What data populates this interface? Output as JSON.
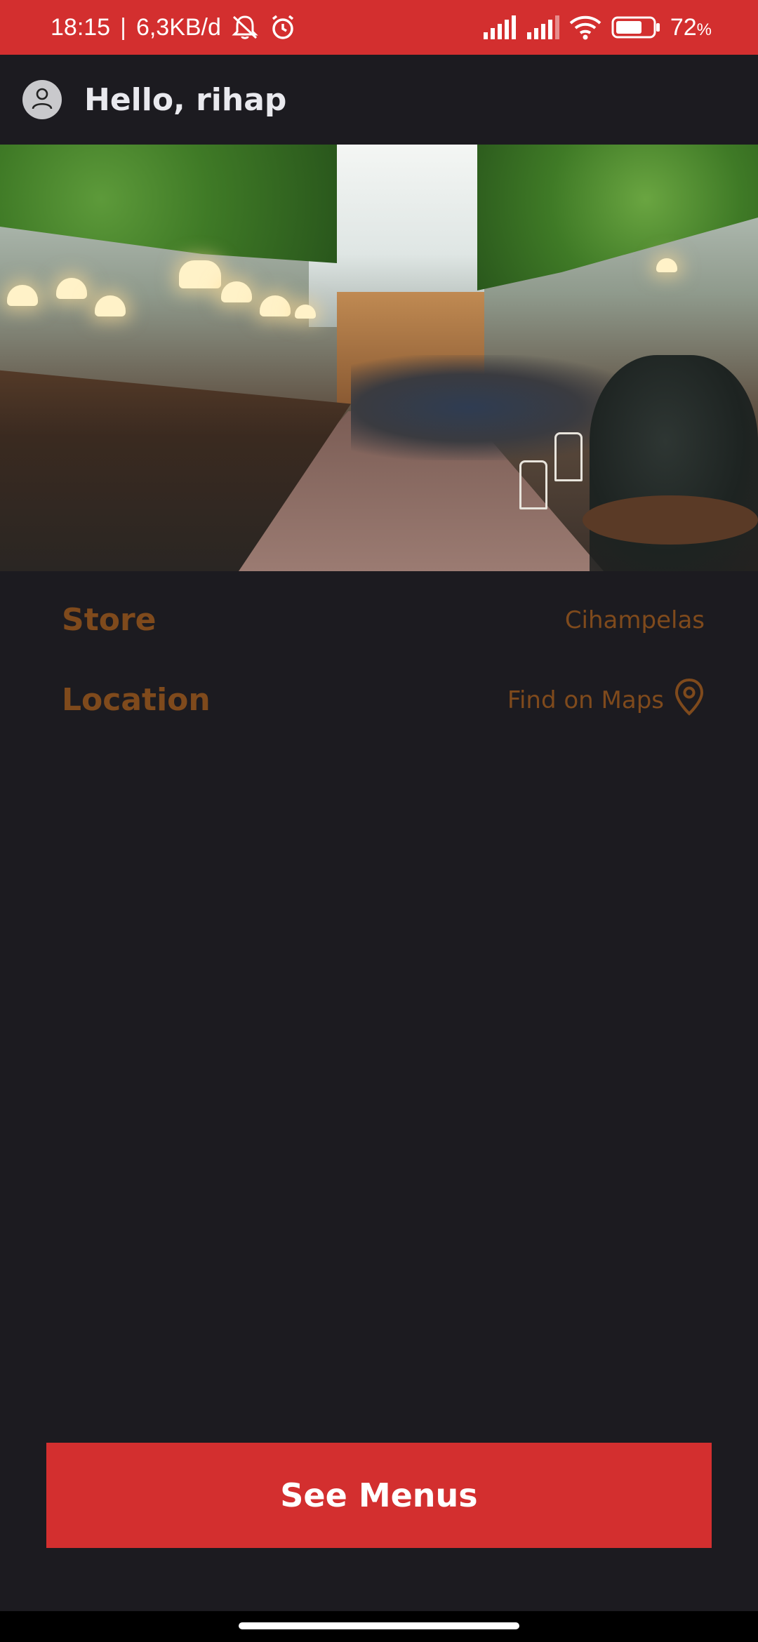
{
  "status_bar": {
    "time": "18:15",
    "separator": "|",
    "network_speed": "6,3KB/d",
    "battery_percent": "72",
    "battery_unit": "%",
    "battery_level": 0.72,
    "icons": [
      "mute-icon",
      "alarm-icon",
      "signal-icon",
      "signal-icon-2",
      "wifi-icon",
      "battery-icon"
    ]
  },
  "header": {
    "greeting": "Hello, rihap",
    "avatar_icon": "user-icon"
  },
  "hero": {
    "image": "restaurant-interior-photo"
  },
  "store": {
    "label": "Store",
    "value": "Cihampelas"
  },
  "location": {
    "label": "Location",
    "link_text": "Find on Maps",
    "icon": "map-pin-icon"
  },
  "actions": {
    "see_menus_label": "See Menus"
  },
  "colors": {
    "accent": "#d32f2f",
    "background": "#1c1b20",
    "info_text": "#7f4a1c",
    "header_text": "#e9e9ee"
  }
}
